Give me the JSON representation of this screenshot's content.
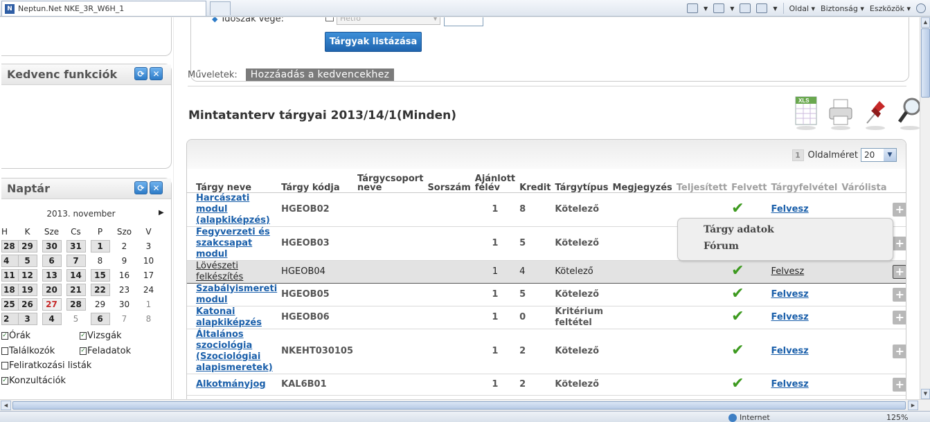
{
  "browser": {
    "tab_title": "Neptun.Net NKE_3R_W6H_1",
    "favicon_letter": "N",
    "menu": {
      "oldal": "Oldal",
      "biztonsag": "Biztonság",
      "eszkozok": "Eszközök"
    },
    "status_zone": "Internet",
    "zoom": "125%"
  },
  "left": {
    "favorites_title": "Kedvenc funkciók",
    "calendar_title": "Naptár",
    "month": "2013. november",
    "weekdays": [
      "H",
      "K",
      "Sze",
      "Cs",
      "P",
      "Szo",
      "V"
    ],
    "weeks": [
      [
        "28",
        "29",
        "30",
        "31",
        "1",
        "2",
        "3"
      ],
      [
        "4",
        "5",
        "6",
        "7",
        "8",
        "9",
        "10"
      ],
      [
        "11",
        "12",
        "13",
        "14",
        "15",
        "16",
        "17"
      ],
      [
        "18",
        "19",
        "20",
        "21",
        "22",
        "23",
        "24"
      ],
      [
        "25",
        "26",
        "27",
        "28",
        "29",
        "30",
        "1"
      ],
      [
        "2",
        "3",
        "4",
        "5",
        "6",
        "7",
        "8"
      ]
    ],
    "legend": {
      "orak": "Órák",
      "vizsgak": "Vizsgák",
      "talalkozok": "Találkozók",
      "feladatok": "Feladatok",
      "feliratkozasi": "Feliratkozási listák",
      "konzultaciok": "Konzultációk"
    }
  },
  "filter": {
    "period_end_label": "Időszak vége:",
    "day_select": "Hétfő",
    "list_button": "Tárgyak listázása"
  },
  "operations": {
    "label": "Műveletek:",
    "add_favorite": "Hozzáadás a kedvencekhez"
  },
  "section_title": "Mintatanterv tárgyai 2013/14/1(Minden)",
  "pager": {
    "page": "1",
    "page_size_label": "Oldalméret",
    "page_size": "20"
  },
  "columns": [
    "Tárgy neve",
    "Tárgy kódja",
    "Tárgycsoport neve",
    "Sorszám",
    "Ajánlott félév",
    "Kredit",
    "Tárgytípus",
    "Megjegyzés",
    "Teljesített",
    "Felvett",
    "Tárgyfelvétel",
    "Várólista"
  ],
  "rows": [
    {
      "name": "Harcászati modul (alapkiképzés)",
      "code": "HGEOB02",
      "semester": "1",
      "credit": "8",
      "type": "Kötelező",
      "felvett": true,
      "action": "Felvesz"
    },
    {
      "name": "Fegyverzeti és szakcsapat modul",
      "code": "HGEOB03",
      "semester": "1",
      "credit": "5",
      "type": "Kötelező",
      "felvett": false,
      "action": ""
    },
    {
      "name": "Lövészeti felkészítés",
      "code": "HGEOB04",
      "semester": "1",
      "credit": "4",
      "type": "Kötelező",
      "felvett": true,
      "action": "Felvesz"
    },
    {
      "name": "Szabályismereti modul",
      "code": "HGEOB05",
      "semester": "1",
      "credit": "5",
      "type": "Kötelező",
      "felvett": true,
      "action": "Felvesz"
    },
    {
      "name": "Katonai alapkiképzés",
      "code": "HGEOB06",
      "semester": "1",
      "credit": "0",
      "type": "Kritérium feltétel",
      "felvett": true,
      "action": "Felvesz"
    },
    {
      "name": "Általános szociológia (Szociológiai alapismeretek)",
      "code": "NKEHT030105",
      "semester": "1",
      "credit": "2",
      "type": "Kötelező",
      "felvett": true,
      "action": "Felvesz"
    },
    {
      "name": "Alkotmányjog",
      "code": "KAL6B01",
      "semester": "1",
      "credit": "2",
      "type": "Kötelező",
      "felvett": true,
      "action": "Felvesz"
    }
  ],
  "context_menu": {
    "item1": "Tárgy adatok",
    "item2": "Fórum"
  },
  "icons": [
    "xls-export-icon",
    "print-icon",
    "pin-icon",
    "search-icon"
  ]
}
